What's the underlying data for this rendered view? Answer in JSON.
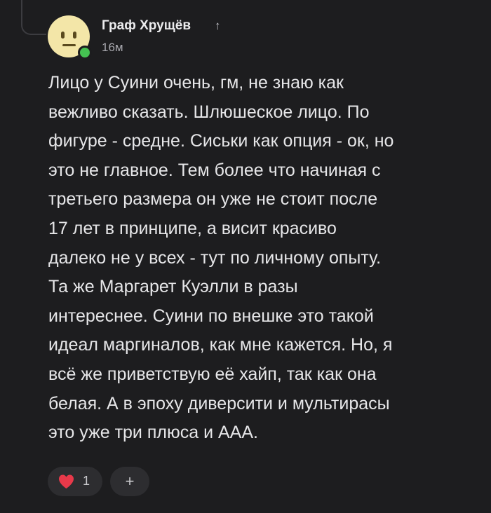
{
  "comment": {
    "author": "Граф Хрущёв",
    "author_badge_icon": "up-arrow-icon",
    "author_badge_glyph": "↑",
    "timestamp": "16м",
    "avatar_icon": "neutral-face-icon",
    "online_status_color": "#45c252",
    "text_lines": [
      "Лицо у Суини очень, гм, не знаю как",
      "вежливо сказать. Шлюшеское лицо. По",
      "фигуре - средне. Сиськи как опция - ок, но",
      "это не главное. Тем более что начиная с",
      "третьего размера он уже не стоит после",
      "17 лет в принципе, а висит красиво",
      "далеко не у всех - тут по личному опыту.",
      "Та же Маргарет Куэлли в разы",
      "интереснее. Суини по внешке это такой",
      "идеал маргиналов, как мне кажется. Но, я",
      "всё же приветствую её хайп, так как она",
      "белая. А в эпоху диверсити и мультирасы",
      "это уже три плюса и ААА."
    ]
  },
  "reactions": {
    "like_icon": "heart-icon",
    "like_color": "#e8394a",
    "like_count": "1",
    "add_icon": "plus-icon",
    "add_glyph": "+"
  }
}
